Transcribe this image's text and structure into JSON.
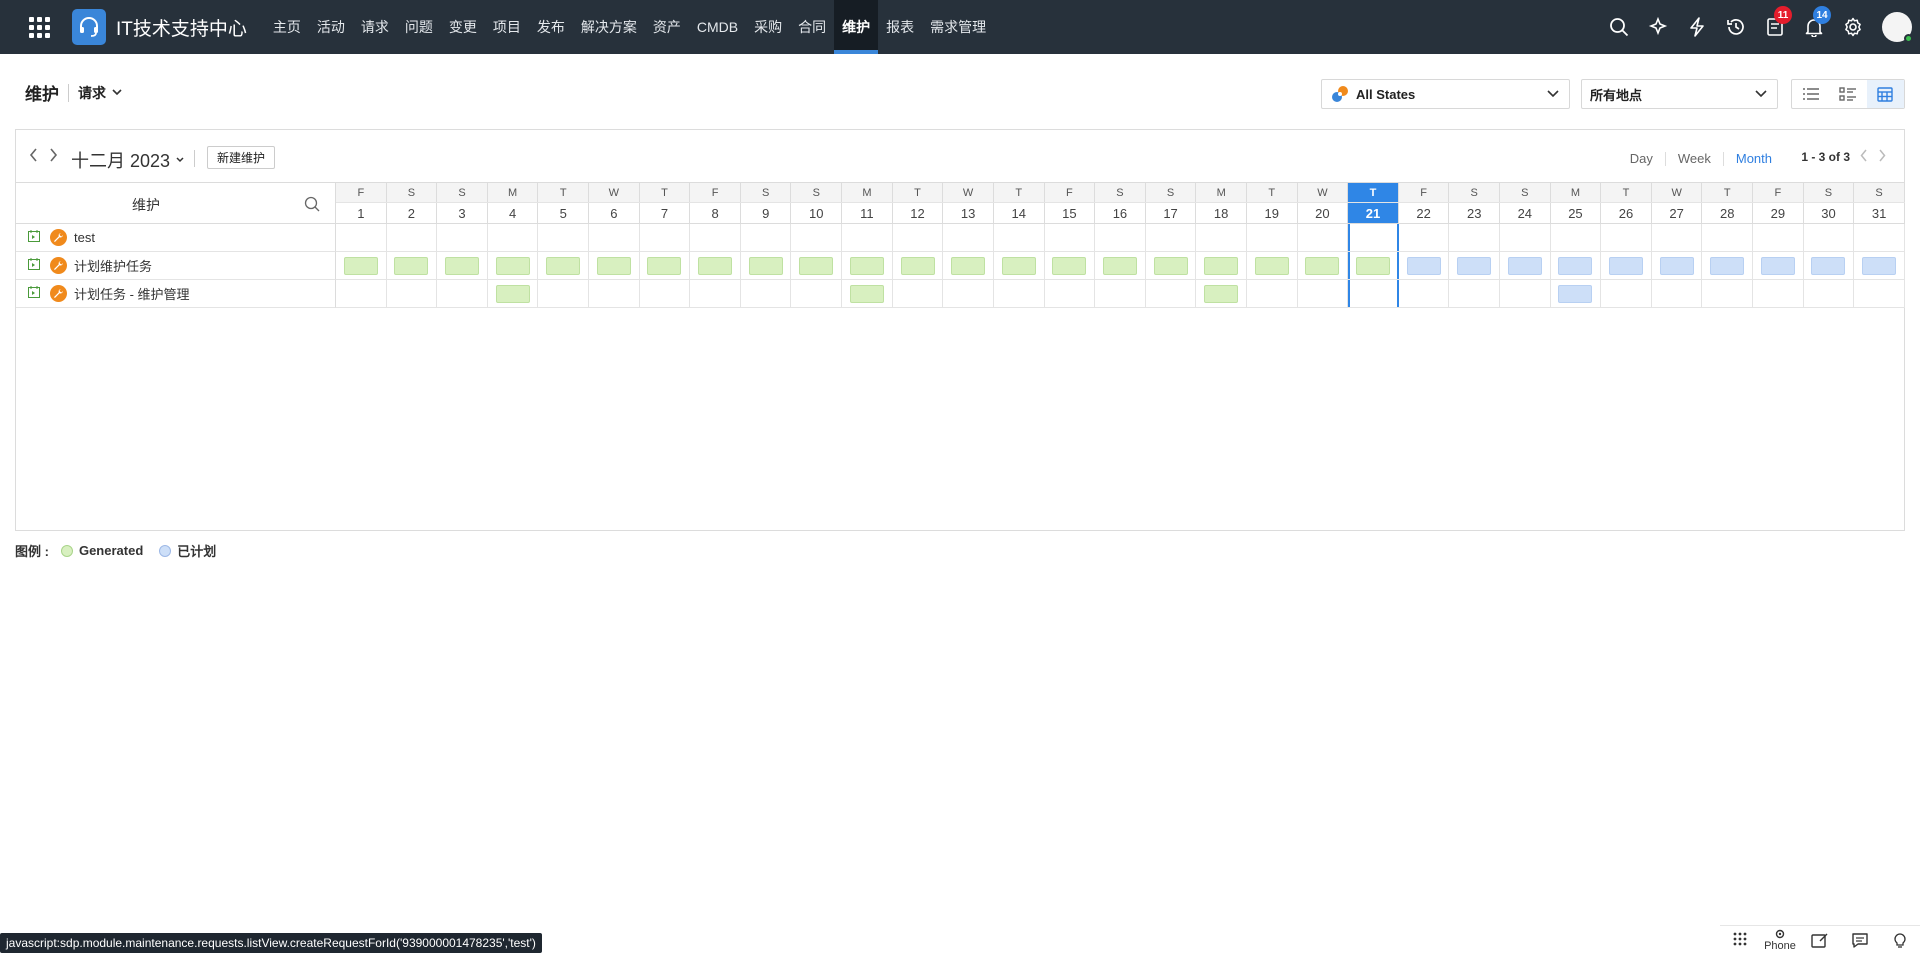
{
  "app": {
    "title": "IT技术支持中心"
  },
  "nav": {
    "items": [
      {
        "label": "主页"
      },
      {
        "label": "活动"
      },
      {
        "label": "请求"
      },
      {
        "label": "问题"
      },
      {
        "label": "变更"
      },
      {
        "label": "项目"
      },
      {
        "label": "发布"
      },
      {
        "label": "解决方案"
      },
      {
        "label": "资产"
      },
      {
        "label": "CMDB"
      },
      {
        "label": "采购"
      },
      {
        "label": "合同"
      },
      {
        "label": "维护",
        "active": true
      },
      {
        "label": "报表"
      },
      {
        "label": "需求管理"
      }
    ]
  },
  "topbar": {
    "icons": [
      "search-icon",
      "magic-icon",
      "bolt-icon",
      "history-icon",
      "tasks-icon",
      "bell-icon",
      "gear-icon"
    ],
    "tasks_badge": "11",
    "bell_badge": "14"
  },
  "header": {
    "title": "维护",
    "module": "请求",
    "state_filter": "All States",
    "site_filter": "所有地点"
  },
  "calendar": {
    "month_label": "十二月 2023",
    "new_button": "新建维护",
    "views": [
      "Day",
      "Week",
      "Month"
    ],
    "active_view": "Month",
    "pager": "1 - 3 of 3",
    "left_header": "维护",
    "today": 21,
    "weekdays": [
      "F",
      "S",
      "S",
      "M",
      "T",
      "W",
      "T",
      "F",
      "S",
      "S",
      "M",
      "T",
      "W",
      "T",
      "F",
      "S",
      "S",
      "M",
      "T",
      "W",
      "T",
      "F",
      "S",
      "S",
      "M",
      "T",
      "W",
      "T",
      "F",
      "S",
      "S"
    ],
    "dates": [
      1,
      2,
      3,
      4,
      5,
      6,
      7,
      8,
      9,
      10,
      11,
      12,
      13,
      14,
      15,
      16,
      17,
      18,
      19,
      20,
      21,
      22,
      23,
      24,
      25,
      26,
      27,
      28,
      29,
      30,
      31
    ],
    "rows": [
      {
        "name": "test",
        "generated": [],
        "planned": []
      },
      {
        "name": "计划维护任务",
        "generated": [
          1,
          2,
          3,
          4,
          5,
          6,
          7,
          8,
          9,
          10,
          11,
          12,
          13,
          14,
          15,
          16,
          17,
          18,
          19,
          20,
          21
        ],
        "planned": [
          22,
          23,
          24,
          25,
          26,
          27,
          28,
          29,
          30,
          31
        ]
      },
      {
        "name": "计划任务 - 维护管理",
        "generated": [
          4,
          11,
          18
        ],
        "planned": [
          25
        ]
      }
    ]
  },
  "legend": {
    "label": "图例 :",
    "items": [
      {
        "label": "Generated",
        "color": "#d8f0c0"
      },
      {
        "label": "已计划",
        "color": "#cddff8"
      }
    ]
  },
  "statusbar": {
    "text": "javascript:sdp.module.maintenance.requests.listView.createRequestForId('939000001478235','test')"
  },
  "bottom": {
    "phone_label": "Phone"
  }
}
